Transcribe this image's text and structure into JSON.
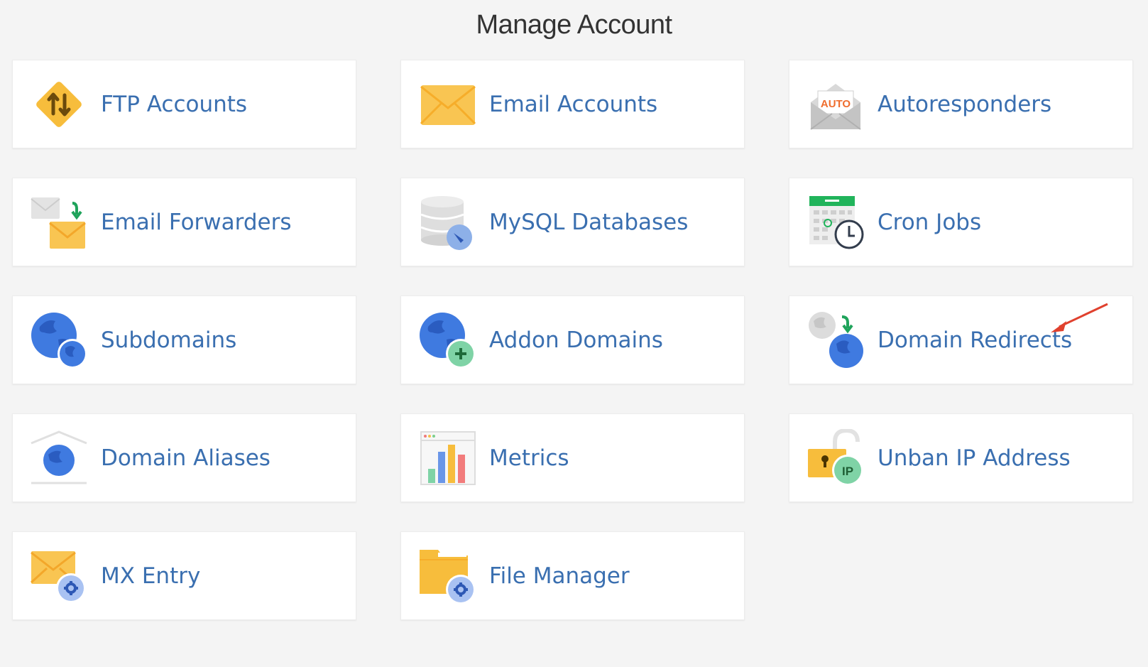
{
  "page": {
    "title": "Manage Account"
  },
  "items": [
    {
      "label": "FTP Accounts",
      "icon": "ftp-icon"
    },
    {
      "label": "Email Accounts",
      "icon": "envelope-icon"
    },
    {
      "label": "Autoresponders",
      "icon": "auto-envelope-icon"
    },
    {
      "label": "Email Forwarders",
      "icon": "email-forward-icon"
    },
    {
      "label": "MySQL Databases",
      "icon": "database-icon"
    },
    {
      "label": "Cron Jobs",
      "icon": "calendar-clock-icon"
    },
    {
      "label": "Subdomains",
      "icon": "globe-sub-icon"
    },
    {
      "label": "Addon Domains",
      "icon": "globe-plus-icon"
    },
    {
      "label": "Domain Redirects",
      "icon": "globe-redirect-icon"
    },
    {
      "label": "Domain Aliases",
      "icon": "globe-house-icon"
    },
    {
      "label": "Metrics",
      "icon": "bar-chart-icon"
    },
    {
      "label": "Unban IP Address",
      "icon": "lock-ip-icon"
    },
    {
      "label": "MX Entry",
      "icon": "envelope-gear-icon"
    },
    {
      "label": "File Manager",
      "icon": "folder-gear-icon"
    }
  ],
  "colors": {
    "label_text": "#3a6fb0",
    "background": "#f4f4f4",
    "annotation_arrow": "#e0412e"
  }
}
